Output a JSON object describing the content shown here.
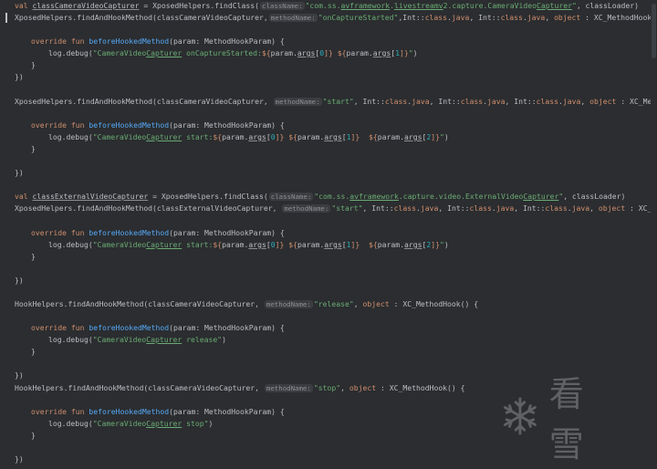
{
  "hints": {
    "className": "className:",
    "methodName": "methodName:"
  },
  "watermark": {
    "text": "看雪",
    "icon": "snowflake-icon"
  },
  "code": {
    "l1": {
      "val": "val",
      "var": "classCameraVideoCapturer",
      "assign": " = XposedHelpers.findClass(",
      "str": "\"com.ss.avframework.livestreamv2.capture.CameraVideoCapturer\"",
      "tail": ", classLoader)"
    },
    "l2": {
      "pre": "XposedHelpers.findAndHookMethod(classCameraVideoCapturer,",
      "str": "\"onCaptureStarted\"",
      "mid1": ",Int::",
      "kwclass1": "class",
      "dot1": ".",
      "java1": "java",
      "mid2": ", Int::",
      "kwclass2": "class",
      "dot2": ".",
      "java2": "java",
      "sep": ", ",
      "object": "object",
      "tail": " : XC_MethodHook() {"
    },
    "l4": {
      "override": "override",
      "fun": "fun",
      "name": "beforeHookedMethod",
      "tail": "(param: MethodHookParam) {"
    },
    "l5": {
      "pre": "log.debug(",
      "str1": "\"CameraVideoCapturer onCaptureStarted:",
      "t1": "${",
      "p1": "param.",
      "args1": "args",
      "i1": "[",
      "n1": "0",
      "c1": "]}",
      "sp": " ",
      "t2": "${",
      "p2": "param.",
      "args2": "args",
      "i2": "[",
      "n2": "1",
      "c2": "]}",
      "end": "\"",
      "close": ")"
    },
    "close_brace": "}",
    "close_paren": "})",
    "l8": {
      "pre": "XposedHelpers.findAndHookMethod(classCameraVideoCapturer,",
      "str": "\"start\"",
      "mid1": ", Int::",
      "kwclass1": "class",
      "dot1": ".",
      "java1": "java",
      "mid2": ", Int::",
      "kwclass2": "class",
      "dot2": ".",
      "java2": "java",
      "mid3": ", Int::",
      "kwclass3": "class",
      "dot3": ".",
      "java3": "java",
      "sep": ", ",
      "object": "object",
      "tail": " : XC_MethodHo"
    },
    "l11": {
      "str_a": "\"CameraVideoCapturer start:",
      "str_b": "  "
    },
    "l16": {
      "var": "classExternalVideoCapturer",
      "str": "\"com.ss.avframework.capture.video.ExternalVideoCapturer\""
    },
    "l17": {
      "pre": "XposedHelpers.findAndHookMethod(classExternalVideoCapturer,",
      "tail": " : XC_MethodH"
    },
    "l24": {
      "pre": "HookHelpers.findAndHookMethod(classCameraVideoCapturer,",
      "str": "\"release\"",
      "tail": " : XC_MethodHook() {"
    },
    "l27": {
      "str": "\"CameraVideoCapturer release\""
    },
    "l31": {
      "pre": "HookHelpers.findAndHookMethod(classCameraVideoCapturer,",
      "str": "\"stop\""
    },
    "l34": {
      "str": "\"CameraVideoCapturer stop\""
    },
    "n2": "2"
  },
  "colors": {
    "background": "#2b2d30",
    "keyword": "#cf8e6d",
    "function": "#56a8f5",
    "string": "#6aab73",
    "number": "#2aacb8",
    "text": "#bcbec4"
  }
}
